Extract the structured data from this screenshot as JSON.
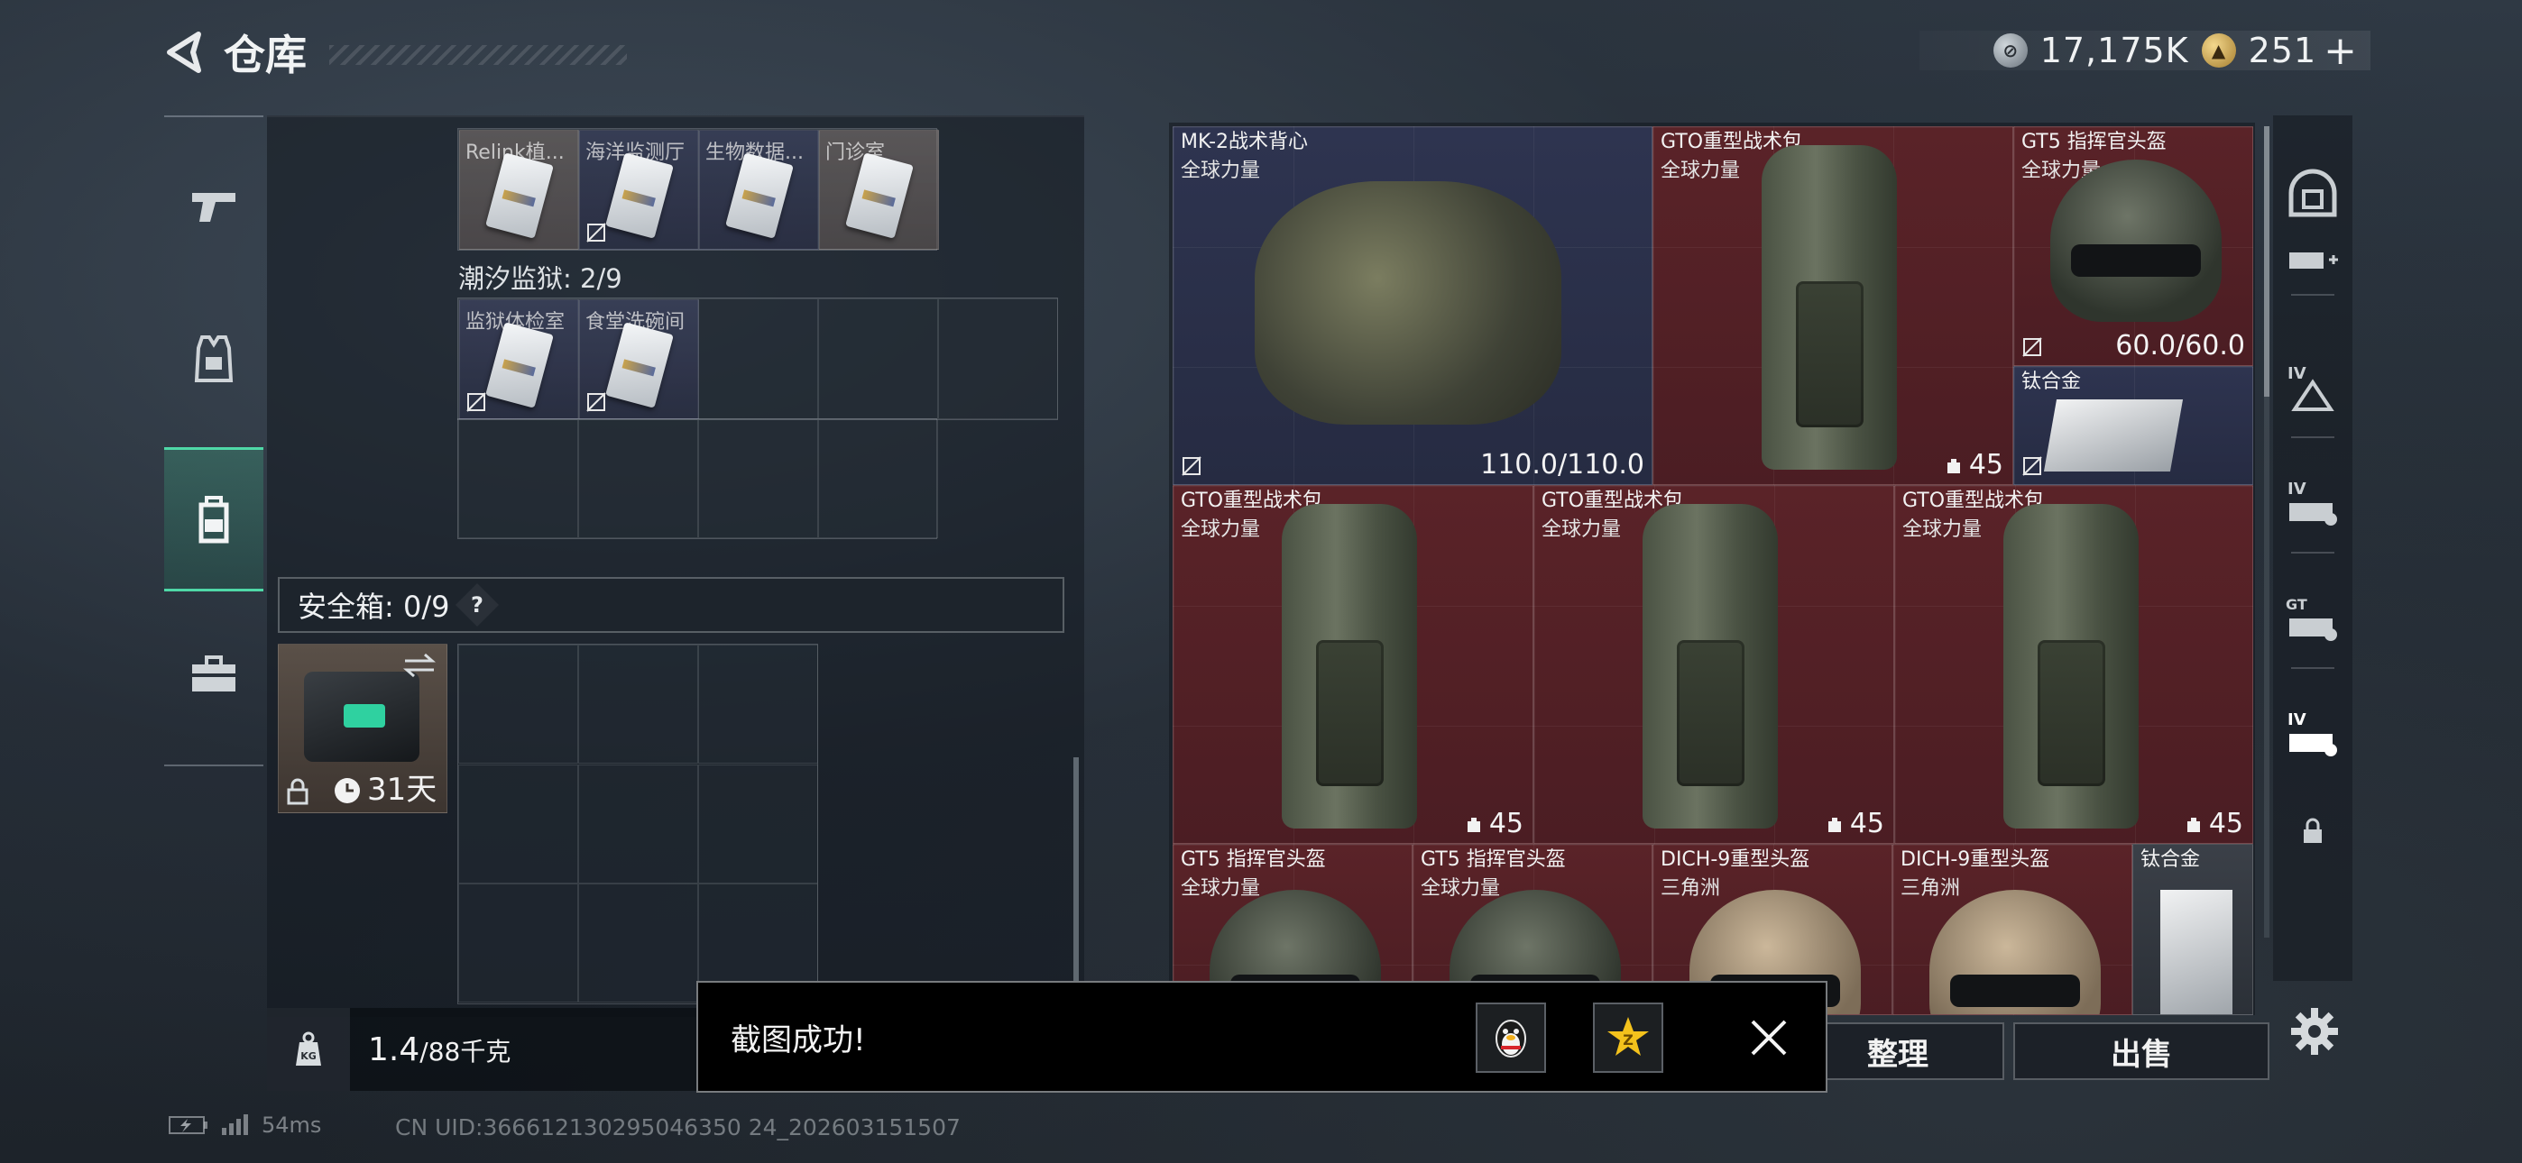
{
  "header": {
    "title": "仓库",
    "currency": {
      "silver_value": "17,175K",
      "gold_value": "251",
      "plus": "+"
    }
  },
  "left_nav": {
    "items": [
      {
        "name": "weapons",
        "icon": "pistol-icon",
        "active": false
      },
      {
        "name": "equipment",
        "icon": "vest-icon",
        "active": false
      },
      {
        "name": "backpack",
        "icon": "backpack-icon",
        "active": true
      },
      {
        "name": "briefcase",
        "icon": "briefcase-icon",
        "active": false
      }
    ]
  },
  "keycards_row1": [
    {
      "label": "Relink植..."
    },
    {
      "label": "海洋监测厅"
    },
    {
      "label": "生物数据..."
    },
    {
      "label": "门诊室"
    }
  ],
  "prison_section": {
    "label": "潮汐监狱: 2/9"
  },
  "keycards_row2": [
    {
      "label": "监狱体检室"
    },
    {
      "label": "食堂洗碗间"
    }
  ],
  "safebox": {
    "label": "安全箱: 0/9",
    "help": "?",
    "days": "31天"
  },
  "weight": {
    "value": "1.4",
    "capacity": "/88千克"
  },
  "stash_items": [
    {
      "name": "MK-2战术背心",
      "sub": "全球力量",
      "durability": "110.0/110.0"
    },
    {
      "name": "GTO重型战术包",
      "sub": "全球力量",
      "capacity": "45"
    },
    {
      "name": "GT5 指挥官头盔",
      "sub": "全球力量",
      "durability": "60.0/60.0"
    },
    {
      "name": "钛合金"
    },
    {
      "name": "GTO重型战术包",
      "sub": "全球力量",
      "capacity": "45"
    },
    {
      "name": "GTO重型战术包",
      "sub": "全球力量",
      "capacity": "45"
    },
    {
      "name": "GTO重型战术包",
      "sub": "全球力量",
      "capacity": "45"
    },
    {
      "name": "GT5 指挥官头盔",
      "sub": "全球力量"
    },
    {
      "name": "GT5 指挥官头盔",
      "sub": "全球力量"
    },
    {
      "name": "DICH-9重型头盔",
      "sub": "三角洲"
    },
    {
      "name": "DICH-9重型头盔",
      "sub": "三角洲"
    },
    {
      "name": "钛合金"
    }
  ],
  "right_nav": {
    "items": [
      "helmet-slot-icon",
      "armor-add-icon",
      "tier-iv-helmet-icon",
      "tier-iv-rig-icon",
      "gt-rig-icon",
      "tier-iv-rig-selected-icon",
      "lock-icon"
    ]
  },
  "actions": {
    "organize": "整理",
    "sell": "出售"
  },
  "toast": {
    "message": "截图成功!"
  },
  "footer": {
    "ping": "54ms",
    "uid": "CN UID:366612130295046350 24_202603151507"
  }
}
